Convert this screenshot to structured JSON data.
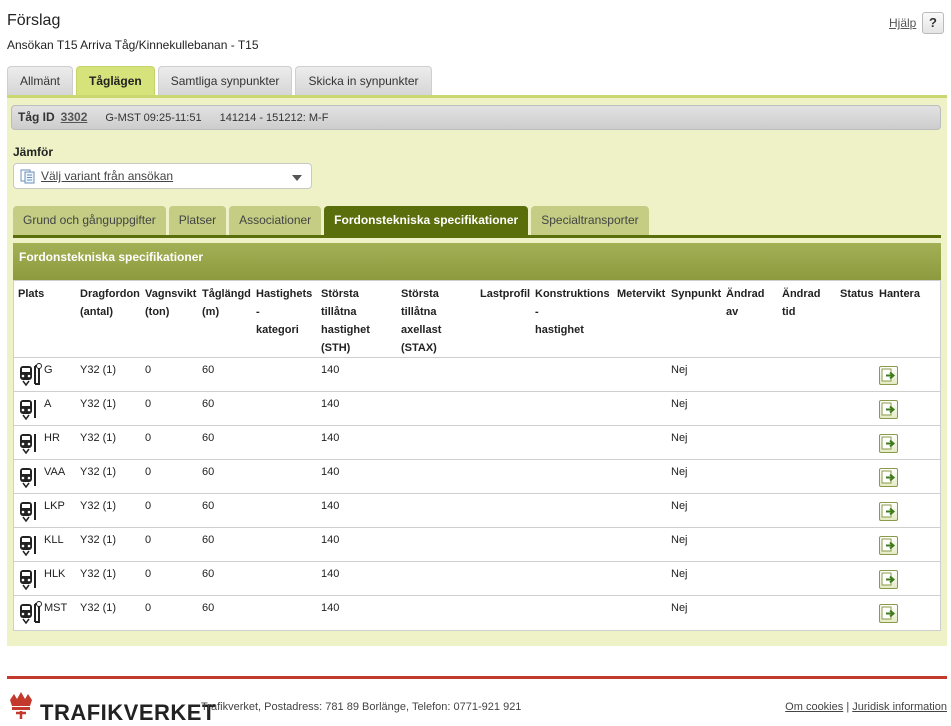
{
  "page": {
    "title": "Förslag",
    "subtitle": "Ansökan T15 Arriva Tåg/Kinnekullebanan - T15",
    "help_label": "Hjälp",
    "help_button": "?"
  },
  "main_tabs": [
    "Allmänt",
    "Tåglägen",
    "Samtliga synpunkter",
    "Skicka in synpunkter"
  ],
  "main_tab_active": "Tåglägen",
  "train": {
    "label": "Tåg ID",
    "id": "3302",
    "route": "G-MST 09:25-11:51",
    "period": "141214 - 151212: M-F"
  },
  "compare": {
    "label": "Jämför",
    "select_value": "Välj variant från ansökan"
  },
  "sub_tabs": [
    "Grund och gånguppgifter",
    "Platser",
    "Associationer",
    "Fordonstekniska specifikationer",
    "Specialtransporter"
  ],
  "sub_tab_active": "Fordonstekniska specifikationer",
  "section": {
    "title": "Fordonstekniska specifikationer"
  },
  "table": {
    "headers": {
      "plats": "Plats",
      "dragfordon": "Dragfordon\n(antal)",
      "vagnsvikt": "Vagnsvikt\n(ton)",
      "taglangd": "Tåglängd\n(m)",
      "hastighetskategori": "Hastighets\n-\nkategori",
      "sth": "Största\ntillåtna\nhastighet\n(STH)",
      "stax": "Största\ntillåtna\naxellast\n(STAX)",
      "lastprofil": "Lastprofil",
      "konstruktionshastighet": "Konstruktions\n-\nhastighet",
      "metervikt": "Metervikt",
      "synpunkt": "Synpunkt",
      "andrad_av": "Ändrad\nav",
      "andrad_tid": "Ändrad\ntid",
      "status": "Status",
      "hantera": "Hantera"
    },
    "rows": [
      {
        "plats": "G",
        "terminal": true,
        "dragfordon": "Y32 (1)",
        "vagnsvikt": "0",
        "taglangd": "60",
        "sth": "140",
        "synpunkt": "Nej"
      },
      {
        "plats": "A",
        "terminal": false,
        "dragfordon": "Y32 (1)",
        "vagnsvikt": "0",
        "taglangd": "60",
        "sth": "140",
        "synpunkt": "Nej"
      },
      {
        "plats": "HR",
        "terminal": false,
        "dragfordon": "Y32 (1)",
        "vagnsvikt": "0",
        "taglangd": "60",
        "sth": "140",
        "synpunkt": "Nej"
      },
      {
        "plats": "VAA",
        "terminal": false,
        "dragfordon": "Y32 (1)",
        "vagnsvikt": "0",
        "taglangd": "60",
        "sth": "140",
        "synpunkt": "Nej"
      },
      {
        "plats": "LKP",
        "terminal": false,
        "dragfordon": "Y32 (1)",
        "vagnsvikt": "0",
        "taglangd": "60",
        "sth": "140",
        "synpunkt": "Nej"
      },
      {
        "plats": "KLL",
        "terminal": false,
        "dragfordon": "Y32 (1)",
        "vagnsvikt": "0",
        "taglangd": "60",
        "sth": "140",
        "synpunkt": "Nej"
      },
      {
        "plats": "HLK",
        "terminal": false,
        "dragfordon": "Y32 (1)",
        "vagnsvikt": "0",
        "taglangd": "60",
        "sth": "140",
        "synpunkt": "Nej"
      },
      {
        "plats": "MST",
        "terminal": true,
        "dragfordon": "Y32 (1)",
        "vagnsvikt": "0",
        "taglangd": "60",
        "sth": "140",
        "synpunkt": "Nej"
      }
    ]
  },
  "footer": {
    "logo_text": "TRAFIKVERKET",
    "address": "Trafikverket, Postadress: 781 89 Borlänge, Telefon: 0771-921 921",
    "cookies_link": "Om cookies",
    "separator": "|",
    "legal_link": "Juridisk information"
  },
  "colors": {
    "accent_green": "#c9d870",
    "dark_green": "#5a6e0c",
    "footer_red": "#c33a2c"
  },
  "icons": [
    "train-icon",
    "document-icon",
    "manage-arrow-icon",
    "crown-icon"
  ]
}
